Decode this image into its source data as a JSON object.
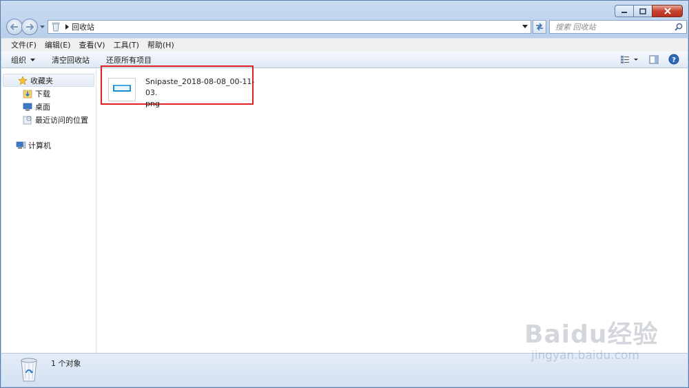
{
  "window": {
    "caption_icons": [
      "minimize-icon",
      "maximize-icon",
      "close-icon"
    ]
  },
  "navigation": {
    "back_icon": "back-arrow-icon",
    "forward_icon": "forward-arrow-icon",
    "address_path": "回收站",
    "search_placeholder": "搜索 回收站"
  },
  "menu": {
    "items": [
      "文件(F)",
      "编辑(E)",
      "查看(V)",
      "工具(T)",
      "帮助(H)"
    ]
  },
  "command_bar": {
    "organize": "组织",
    "empty_recycle_bin": "清空回收站",
    "restore_all": "还原所有项目"
  },
  "sidebar": {
    "favorites": "收藏夹",
    "downloads": "下载",
    "desktop": "桌面",
    "recent_places": "最近访问的位置",
    "computer": "计算机"
  },
  "files": [
    {
      "name_line1": "Snipaste_2018-08-08_00-11-03.",
      "name_line2": "png"
    }
  ],
  "status_bar": {
    "item_count": "1 个对象"
  },
  "watermark": {
    "main": "Baidu经验",
    "sub": "jingyan.baidu.com"
  },
  "colors": {
    "highlight_border": "#e02020",
    "accent": "#1a8fd6"
  }
}
